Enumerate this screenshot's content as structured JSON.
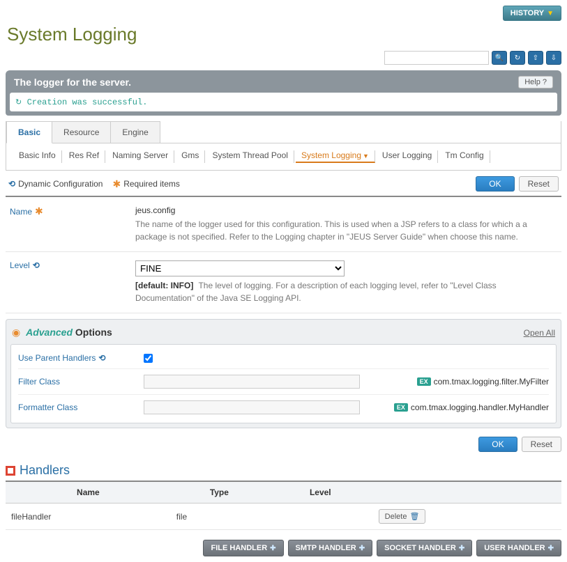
{
  "header": {
    "history": "HISTORY",
    "title": "System Logging"
  },
  "toolbar_icons": {
    "search": "search-icon",
    "i1": "refresh-icon",
    "i2": "xml-export-icon",
    "i3": "xml-import-icon"
  },
  "banner": {
    "title": "The logger for the server.",
    "help": "Help ?",
    "message": "Creation was successful."
  },
  "tabs": {
    "main": [
      "Basic",
      "Resource",
      "Engine"
    ],
    "active_main": 0,
    "sub": [
      "Basic Info",
      "Res Ref",
      "Naming Server",
      "Gms",
      "System Thread Pool",
      "System Logging",
      "User Logging",
      "Tm Config"
    ],
    "active_sub": 5
  },
  "legend": {
    "dynamic": "Dynamic Configuration",
    "required": "Required items",
    "ok": "OK",
    "reset": "Reset"
  },
  "form": {
    "name": {
      "label": "Name",
      "value": "jeus.config",
      "desc": "The name of the logger used for this configuration. This is used when a JSP refers to a class for which a a package is not specified. Refer to the Logging chapter in \"JEUS Server Guide\" when choose this name."
    },
    "level": {
      "label": "Level",
      "value": "FINE",
      "default_label": "[default: INFO]",
      "desc": "The level of logging. For a description of each logging level, refer to \"Level Class Documentation\" of the Java SE Logging API."
    }
  },
  "advanced": {
    "title_adv": "Advanced",
    "title_opt": "Options",
    "open_all": "Open All",
    "rows": {
      "use_parent": {
        "label": "Use Parent Handlers",
        "checked": true
      },
      "filter": {
        "label": "Filter Class",
        "ex": "com.tmax.logging.filter.MyFilter"
      },
      "formatter": {
        "label": "Formatter Class",
        "ex": "com.tmax.logging.handler.MyHandler"
      }
    },
    "ex_badge": "EX"
  },
  "handlers": {
    "title": "Handlers",
    "columns": [
      "Name",
      "Type",
      "Level",
      ""
    ],
    "rows": [
      {
        "name": "fileHandler",
        "type": "file",
        "level": "",
        "action": "Delete"
      }
    ]
  },
  "footer": {
    "buttons": [
      "FILE HANDLER",
      "SMTP HANDLER",
      "SOCKET HANDLER",
      "USER HANDLER"
    ]
  }
}
